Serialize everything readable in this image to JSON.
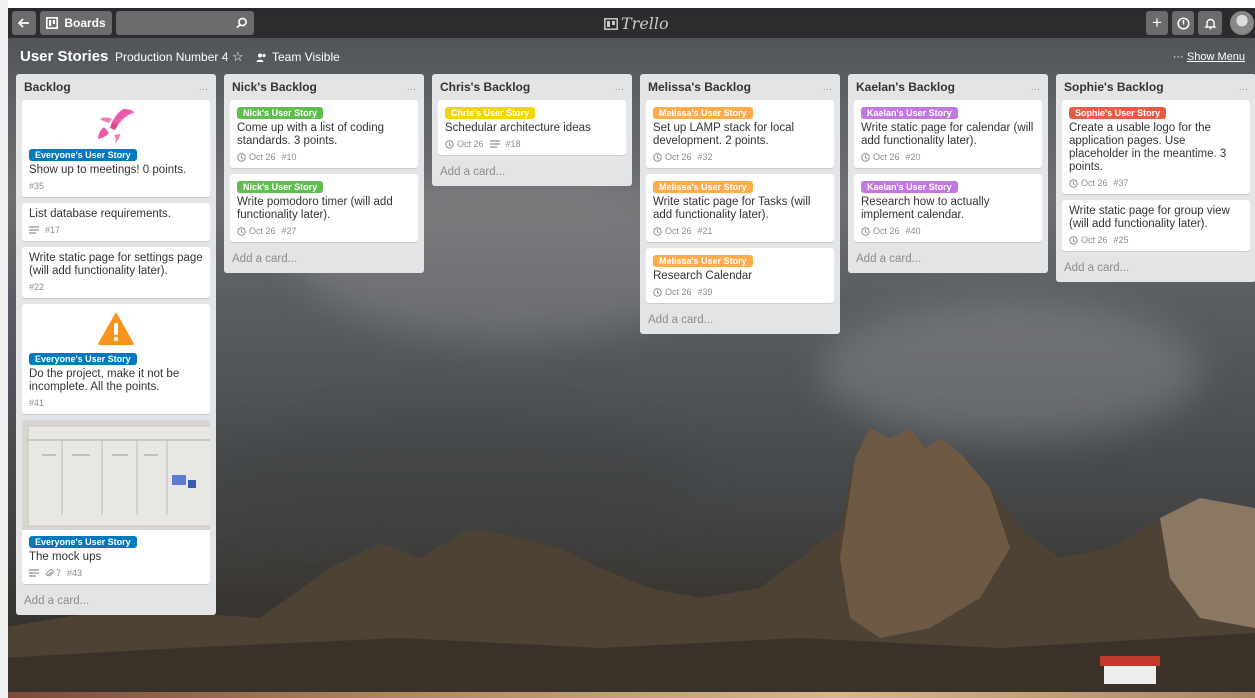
{
  "header": {
    "back_icon": "arrow-left-icon",
    "boards_label": "Boards",
    "search_value": "",
    "search_icon": "search-icon",
    "logo_text": "Trello",
    "add_icon": "plus-icon",
    "info_icon": "info-icon",
    "bell_icon": "bell-icon"
  },
  "board": {
    "title": "User Stories",
    "org": "Production Number 4",
    "visibility": "Team Visible",
    "menu_prefix": "···",
    "menu_label": "Show Menu"
  },
  "colors": {
    "blue": "#0079bf",
    "green": "#61bd4f",
    "yellow": "#f2d600",
    "orange": "#ffab4a",
    "purple": "#c377e0",
    "red": "#eb5a46"
  },
  "lists": [
    {
      "title": "Backlog",
      "more": "...",
      "add": "Add a card...",
      "cards": [
        {
          "cover": "pink-rocket",
          "label": "Everyone's User Story",
          "label_color": "#0079bf",
          "title": "Show up to meetings! 0 points.",
          "date": "",
          "desc": false,
          "attach": "",
          "num": "#35"
        },
        {
          "cover": "",
          "label": "",
          "label_color": "",
          "title": "List database requirements.",
          "date": "",
          "desc": true,
          "attach": "",
          "num": "#17"
        },
        {
          "cover": "",
          "label": "",
          "label_color": "",
          "title": "Write static page for settings page (will add functionality later).",
          "date": "",
          "desc": false,
          "attach": "",
          "num": "#22"
        },
        {
          "cover": "warning",
          "label": "Everyone's User Story",
          "label_color": "#0079bf",
          "title": "Do the project, make it not be incomplete. All the points.",
          "date": "",
          "desc": false,
          "attach": "",
          "num": "#41"
        },
        {
          "cover": "mockup",
          "label": "Everyone's User Story",
          "label_color": "#0079bf",
          "title": "The mock ups",
          "date": "",
          "desc": true,
          "attach": "7",
          "num": "#43"
        }
      ]
    },
    {
      "title": "Nick's Backlog",
      "more": "...",
      "add": "Add a card...",
      "cards": [
        {
          "cover": "",
          "label": "Nick's User Story",
          "label_color": "#61bd4f",
          "title": "Come up with a list of coding standards. 3 points.",
          "date": "Oct 26",
          "desc": false,
          "attach": "",
          "num": "#10"
        },
        {
          "cover": "",
          "label": "Nick's User Story",
          "label_color": "#61bd4f",
          "title": "Write pomodoro timer (will add functionality later).",
          "date": "Oct 26",
          "desc": false,
          "attach": "",
          "num": "#27"
        }
      ]
    },
    {
      "title": "Chris's Backlog",
      "more": "...",
      "add": "Add a card...",
      "cards": [
        {
          "cover": "",
          "label": "Chris's User Story",
          "label_color": "#f2d600",
          "title": "Schedular architecture ideas",
          "date": "Oct 26",
          "desc": true,
          "attach": "",
          "num": "#18"
        }
      ]
    },
    {
      "title": "Melissa's Backlog",
      "more": "...",
      "add": "Add a card...",
      "cards": [
        {
          "cover": "",
          "label": "Melissa's User Story",
          "label_color": "#ffab4a",
          "title": "Set up LAMP stack for local development. 2 points.",
          "date": "Oct 26",
          "desc": false,
          "attach": "",
          "num": "#32"
        },
        {
          "cover": "",
          "label": "Melissa's User Story",
          "label_color": "#ffab4a",
          "title": "Write static page for Tasks (will add functionality later).",
          "date": "Oct 26",
          "desc": false,
          "attach": "",
          "num": "#21"
        },
        {
          "cover": "",
          "label": "Melissa's User Story",
          "label_color": "#ffab4a",
          "title": "Research Calendar",
          "date": "Oct 26",
          "desc": false,
          "attach": "",
          "num": "#39"
        }
      ]
    },
    {
      "title": "Kaelan's Backlog",
      "more": "...",
      "add": "Add a card...",
      "cards": [
        {
          "cover": "",
          "label": "Kaelan's User Story",
          "label_color": "#c377e0",
          "title": "Write static page for calendar (will add functionality later).",
          "date": "Oct 26",
          "desc": false,
          "attach": "",
          "num": "#20"
        },
        {
          "cover": "",
          "label": "Kaelan's User Story",
          "label_color": "#c377e0",
          "title": "Research how to actually implement calendar.",
          "date": "Oct 26",
          "desc": false,
          "attach": "",
          "num": "#40"
        }
      ]
    },
    {
      "title": "Sophie's Backlog",
      "more": "...",
      "add": "Add a card...",
      "cards": [
        {
          "cover": "",
          "label": "Sophie's User Story",
          "label_color": "#eb5a46",
          "title": "Create a usable logo for the application pages. Use placeholder in the meantime. 3 points.",
          "date": "Oct 26",
          "desc": false,
          "attach": "",
          "num": "#37"
        },
        {
          "cover": "",
          "label": "",
          "label_color": "",
          "title": "Write static page for group view (will add functionality later).",
          "date": "Oct 26",
          "desc": false,
          "attach": "",
          "num": "#25"
        }
      ]
    }
  ]
}
